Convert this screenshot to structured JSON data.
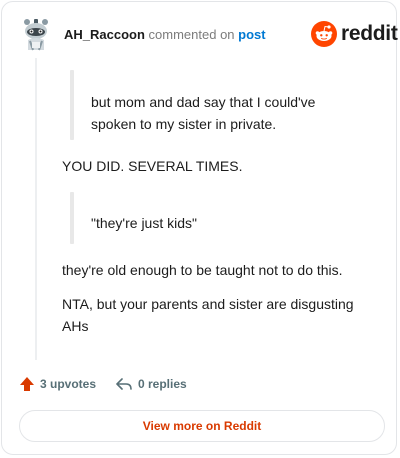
{
  "header": {
    "username": "AH_Raccoon",
    "action_text": "commented on",
    "post_link": "post"
  },
  "brand": {
    "logo_text": "reddit",
    "icon": "reddit-snoo-icon",
    "color": "#ff4500"
  },
  "comment": {
    "quote_1": "but mom and dad say that I could've spoken to my sister in private.",
    "paragraph_1": "YOU DID. SEVERAL TIMES.",
    "quote_2": "\"they're just kids\"",
    "paragraph_2": "they're old enough to be taught not to do this.",
    "paragraph_3": "NTA, but your parents and sister are disgusting AHs"
  },
  "footer": {
    "upvotes_label": "3 upvotes",
    "replies_label": "0 replies",
    "upvote_icon": "upvote-arrow-icon",
    "reply_icon": "reply-arrow-icon"
  },
  "cta": {
    "label": "View more on Reddit",
    "color": "#d93a00"
  }
}
